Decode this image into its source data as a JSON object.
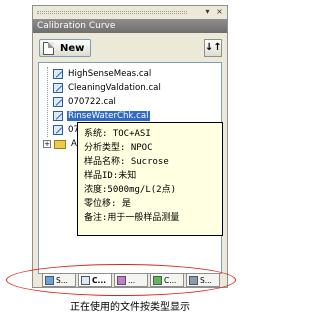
{
  "window": {
    "title": "Calibration Curve",
    "controls": {
      "dropdown": "▾",
      "close": "×"
    }
  },
  "toolbar": {
    "new_label": "New",
    "sort_label": "↓↑"
  },
  "files": [
    {
      "name": "HighSenseMeas.cal",
      "selected": false
    },
    {
      "name": "CleaningValdation.cal",
      "selected": false
    },
    {
      "name": "070722.cal",
      "selected": false
    },
    {
      "name": "RinseWaterChk.cal",
      "selected": true
    },
    {
      "name": "07082..",
      "selected": false
    }
  ],
  "folder": {
    "expander": "+",
    "name": "All Ca.."
  },
  "tooltip": {
    "lines": [
      "系统: TOC+ASI",
      "分析类型: NPOC",
      "样品名称: Sucrose",
      "样品ID:未知",
      "浓度:5000mg/L(2点)",
      "零位移: 是",
      "备注:用于一般样品测量"
    ]
  },
  "tabs": [
    {
      "label": "S...",
      "icon": "sample-table-icon",
      "active": false
    },
    {
      "label": "C...",
      "icon": "calibration-icon",
      "active": true
    },
    {
      "label": "...",
      "icon": "method-icon",
      "active": false
    },
    {
      "label": "C...",
      "icon": "control-icon",
      "active": false
    },
    {
      "label": "S...",
      "icon": "system-icon",
      "active": false
    }
  ],
  "caption": "正在使用的文件按类型显示",
  "colors": {
    "title_bar": "#7e7e7e",
    "selection": "#316ac5",
    "highlight_oval": "#e32020"
  }
}
